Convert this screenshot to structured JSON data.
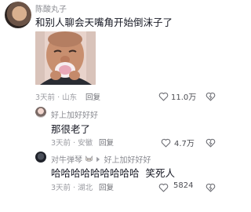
{
  "comments": [
    {
      "username": "陈酸丸子",
      "text": "和别人聊会天嘴角开始倒沫子了",
      "time": "3天前",
      "location": "山东",
      "reply_label": "回复",
      "likes": "11.0万"
    },
    {
      "username": "好上加好好好",
      "text": "那很老了",
      "time": "3天前",
      "location": "安徽",
      "reply_label": "回复",
      "likes": "4.7万"
    },
    {
      "username": "对牛弹琴",
      "reply_to": "好上加好好好",
      "text": "哈哈哈哈哈哈哈哈哈  笑死人",
      "time": "3天前",
      "location": "湖北",
      "reply_label": "回复",
      "likes": "5824"
    }
  ],
  "separator": "·",
  "colors": {
    "meta": "#9a9ba1",
    "text": "#161823",
    "username": "#8a8b91"
  },
  "icons": [
    "heart-icon",
    "dislike-icon",
    "reply-arrow-icon"
  ]
}
